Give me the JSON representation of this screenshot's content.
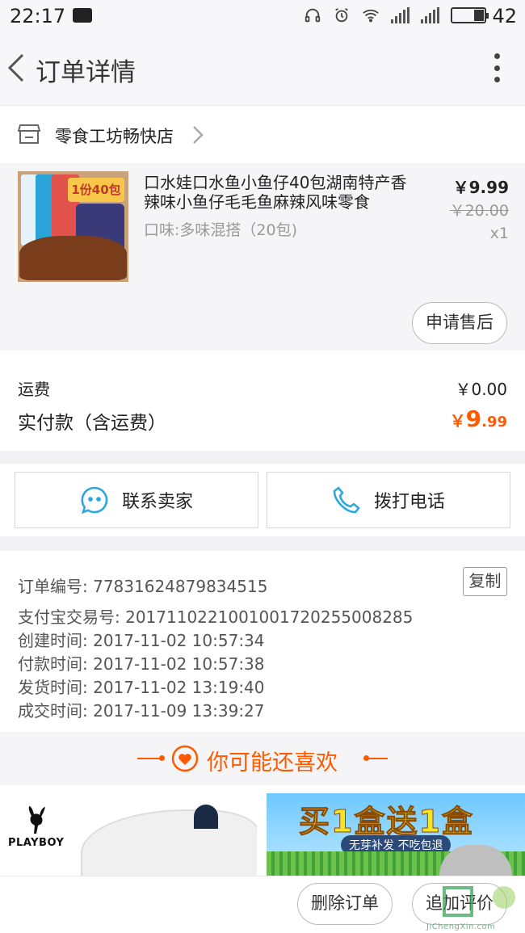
{
  "status_bar": {
    "time": "22:17",
    "battery": "42"
  },
  "nav": {
    "title": "订单详情"
  },
  "shop": {
    "name": "零食工坊畅快店"
  },
  "product": {
    "title": "口水娃口水鱼小鱼仔40包湖南特产香辣味小鱼仔毛毛鱼麻辣风味零食",
    "spec": "口味:多味混搭（20包)",
    "price": "￥9.99",
    "original_price": "￥20.00",
    "quantity": "x1",
    "thumb_badge": "1份40包",
    "after_sale_label": "申请售后"
  },
  "totals": {
    "freight_label": "运费",
    "freight_value": "￥0.00",
    "paid_label": "实付款（含运费）",
    "paid_currency": "￥",
    "paid_int": "9",
    "paid_dec": ".99"
  },
  "contact": {
    "seller_label": "联系卖家",
    "call_label": "拨打电话"
  },
  "order_info": {
    "copy_label": "复制",
    "rows": [
      "订单编号: 77831624879834515",
      "支付宝交易号: 2017110221001001720255008285",
      "创建时间: 2017-11-02 10:57:34",
      "付款时间: 2017-11-02 10:57:38",
      "发货时间: 2017-11-02 13:19:40",
      "成交时间: 2017-11-09 13:39:27"
    ]
  },
  "recommend": {
    "title": "你可能还喜欢",
    "item1_brand": "PLAYBOY",
    "item2_title": "买1盒送1盒",
    "item2_sub": "无芽补发 不吃包退"
  },
  "bottom": {
    "delete_label": "删除订单",
    "review_label": "追加评价"
  },
  "watermark": {
    "text": "JiChengXin.com"
  },
  "colors": {
    "accent": "#ff5a00",
    "contact_icon": "#2ea7e0"
  }
}
